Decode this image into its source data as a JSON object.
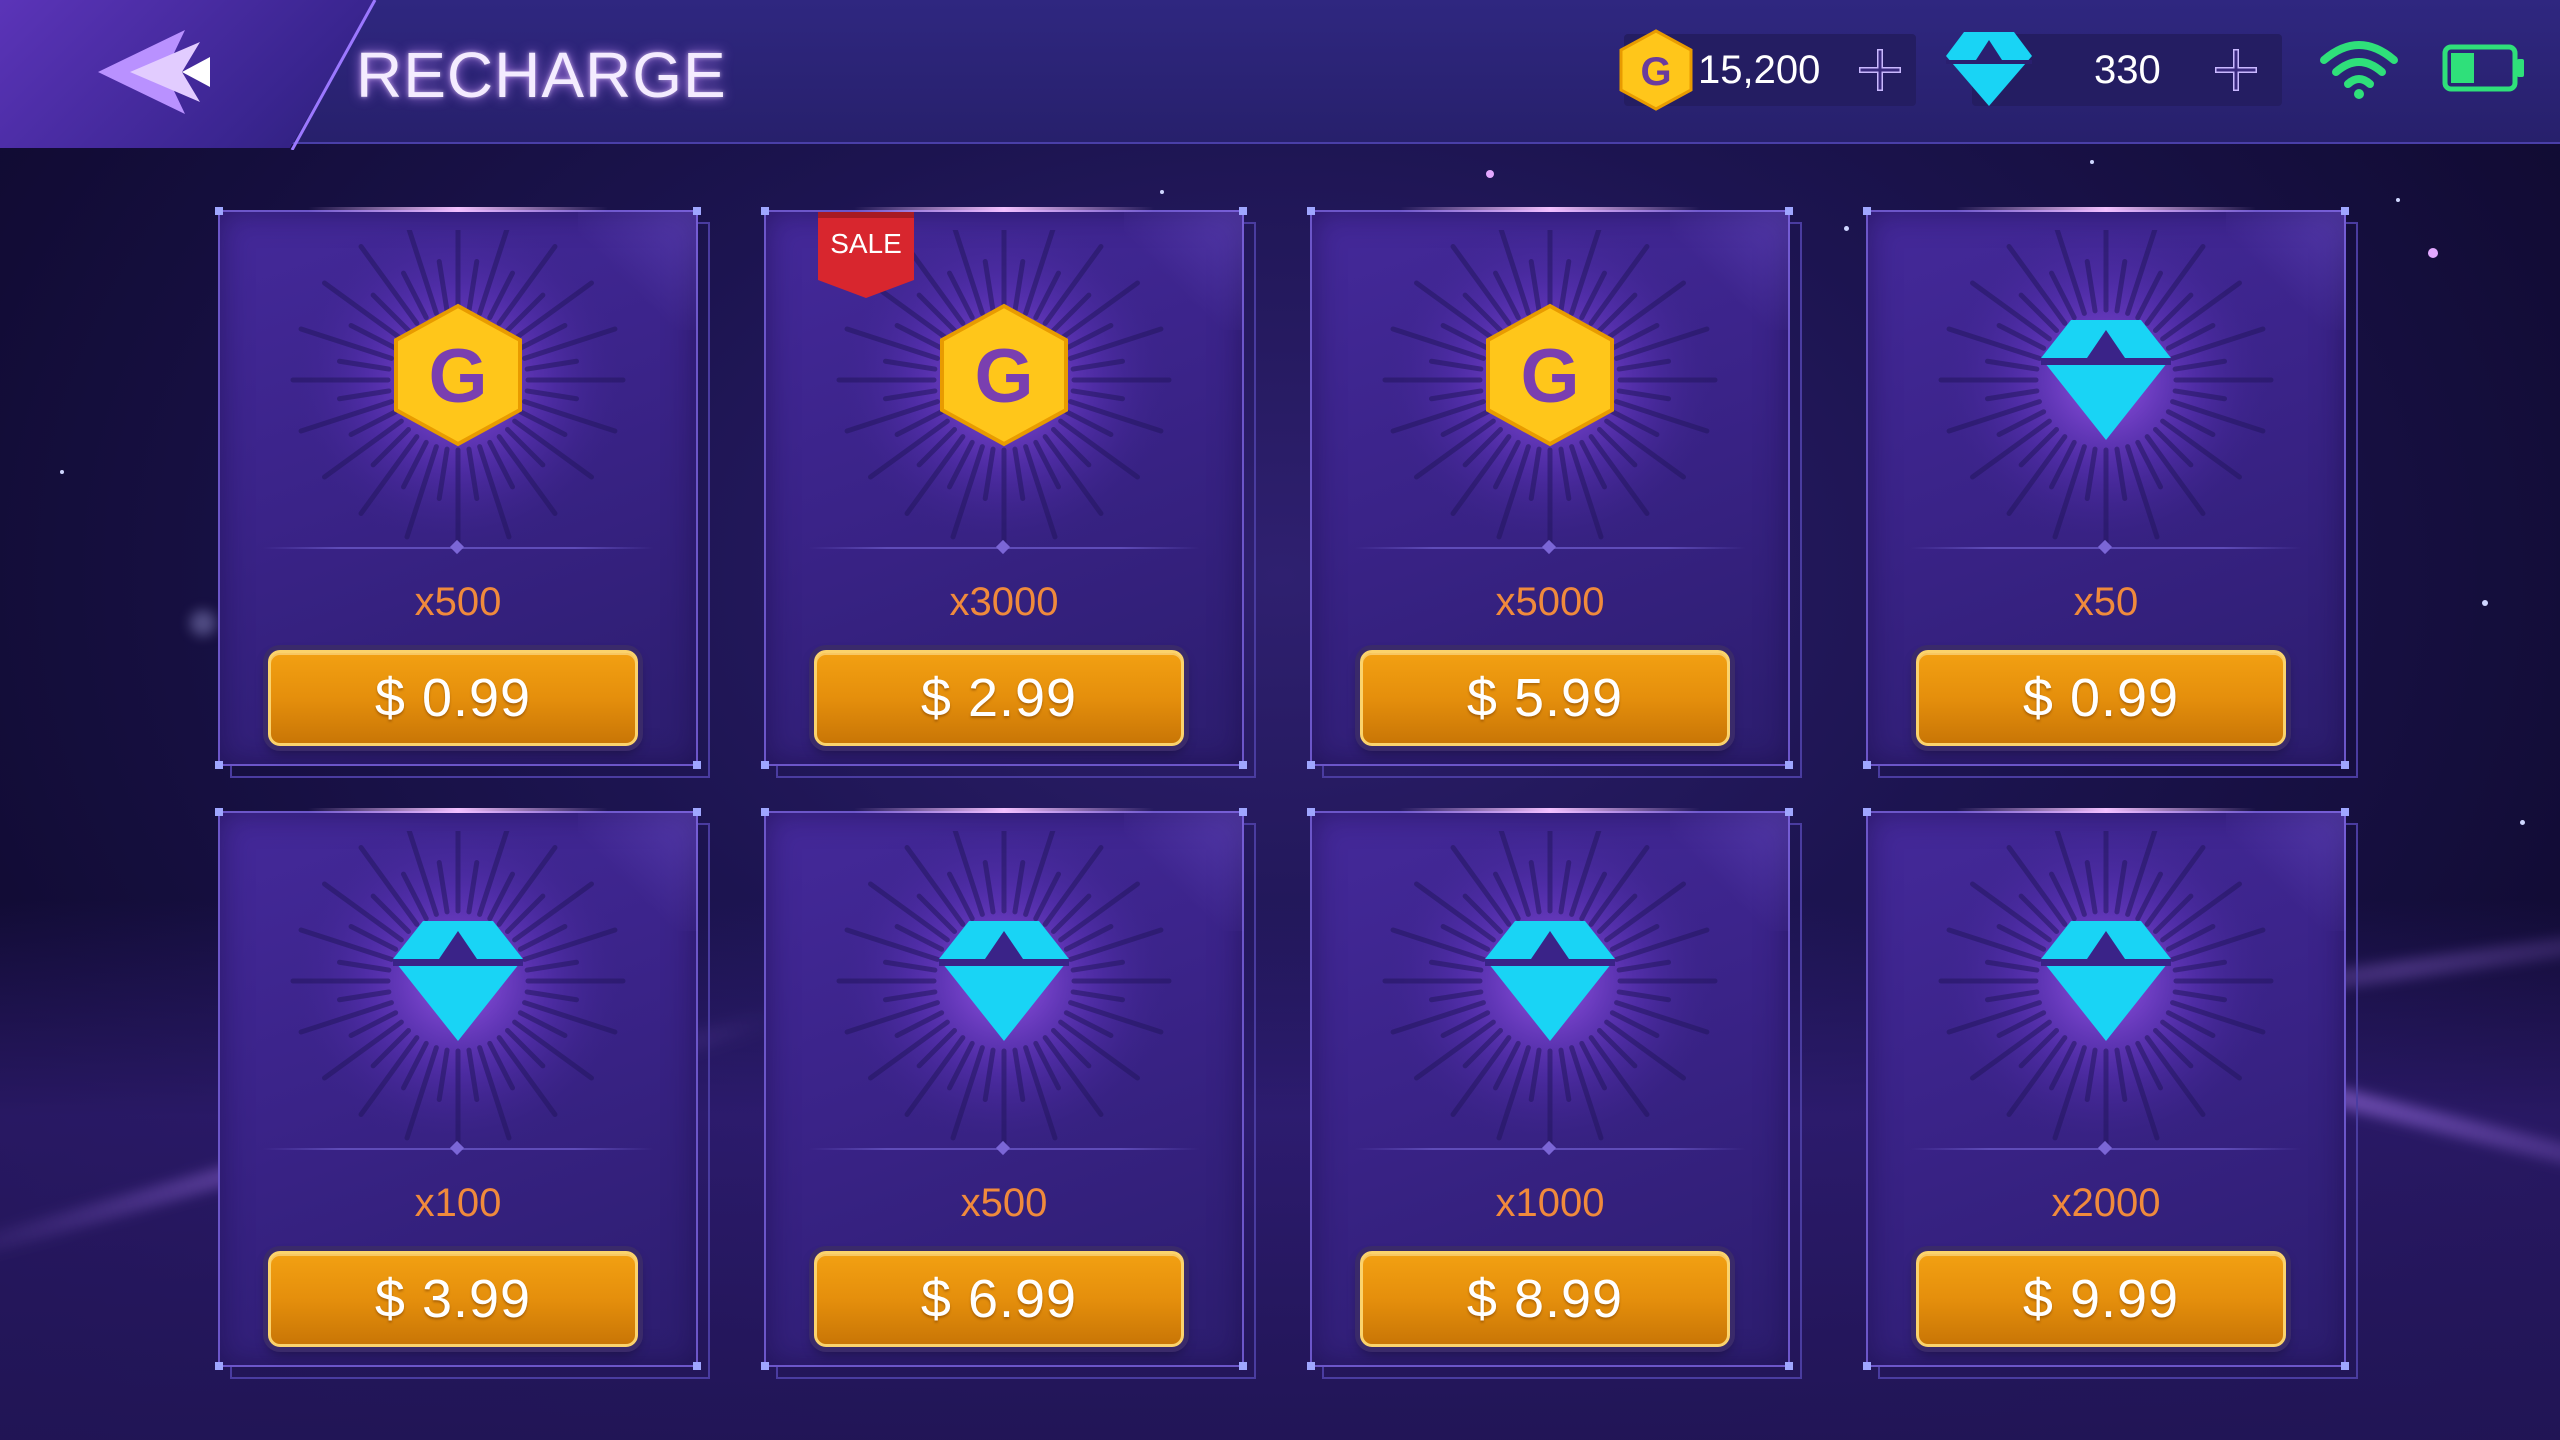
{
  "header": {
    "title": "RECHARGE",
    "gold_balance": "15,200",
    "gem_balance": "330"
  },
  "colors": {
    "accent_purple": "#3a2388",
    "price_gold": "#f2a012",
    "quantity_orange": "#f08a3c",
    "gem_cyan": "#19d4f5",
    "coin_yellow": "#ffc61a",
    "sale_red": "#d8262e",
    "wifi_green": "#2fe07a"
  },
  "products": [
    {
      "currency": "gold",
      "quantity": "x500",
      "price": "$ 0.99",
      "sale": ""
    },
    {
      "currency": "gold",
      "quantity": "x3000",
      "price": "$ 2.99",
      "sale": "SALE"
    },
    {
      "currency": "gold",
      "quantity": "x5000",
      "price": "$ 5.99",
      "sale": ""
    },
    {
      "currency": "gem",
      "quantity": "x50",
      "price": "$ 0.99",
      "sale": ""
    },
    {
      "currency": "gem",
      "quantity": "x100",
      "price": "$ 3.99",
      "sale": ""
    },
    {
      "currency": "gem",
      "quantity": "x500",
      "price": "$ 6.99",
      "sale": ""
    },
    {
      "currency": "gem",
      "quantity": "x1000",
      "price": "$ 8.99",
      "sale": ""
    },
    {
      "currency": "gem",
      "quantity": "x2000",
      "price": "$ 9.99",
      "sale": ""
    }
  ],
  "status": {
    "battery_level": 0.4,
    "wifi_bars": 3
  },
  "icons": {
    "back": "back-arrow-icon",
    "gold": "gold-coin-icon",
    "gem": "diamond-icon",
    "plus": "plus-icon",
    "wifi": "wifi-icon",
    "battery": "battery-icon"
  }
}
